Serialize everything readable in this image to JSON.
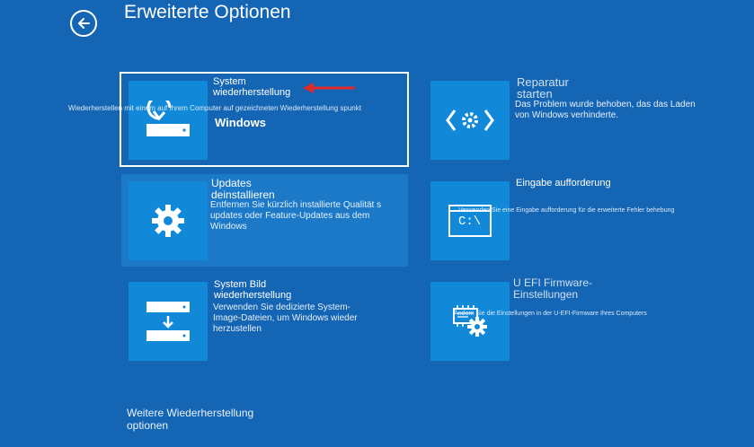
{
  "header": {
    "title": "Erweiterte Optionen"
  },
  "options": {
    "system_restore": {
      "title": "System wiederherstellung",
      "description": "Wiederherstellen mit einem auf Ihrem Computer auf gezeichneten Wiederherstellung spunkt",
      "os_label": "Windows"
    },
    "startup_repair": {
      "title": "Reparatur starten",
      "description": "Das Problem wurde behoben, das das Laden von Windows verhinderte."
    },
    "uninstall_updates": {
      "title": "Updates deinstallieren",
      "description": "Entfernen Sie kürzlich installierte Qualität s updates oder Feature-Updates aus dem Windows"
    },
    "command_prompt": {
      "title": "Eingabe aufforderung",
      "description": "Verwenden Sie eine Eingabe aufforderung für die erweiterte Fehler behebung",
      "icon_text": "C:\\"
    },
    "system_image_recovery": {
      "title": "System Bild wiederherstellung",
      "description": "Verwenden Sie dedizierte System-Image-Dateien, um Windows wieder herzustellen"
    },
    "uefi_settings": {
      "title": "U EFI Firmware-Einstellungen",
      "description": "Ändern Sie die Einstellungen in der U-EFI-Firmware Ihres Computers"
    }
  },
  "footer": {
    "more_options": "Weitere Wiederherstellung optionen"
  },
  "colors": {
    "background": "#1565b5",
    "tile": "#1189d8",
    "arrow": "#e02a2a"
  }
}
